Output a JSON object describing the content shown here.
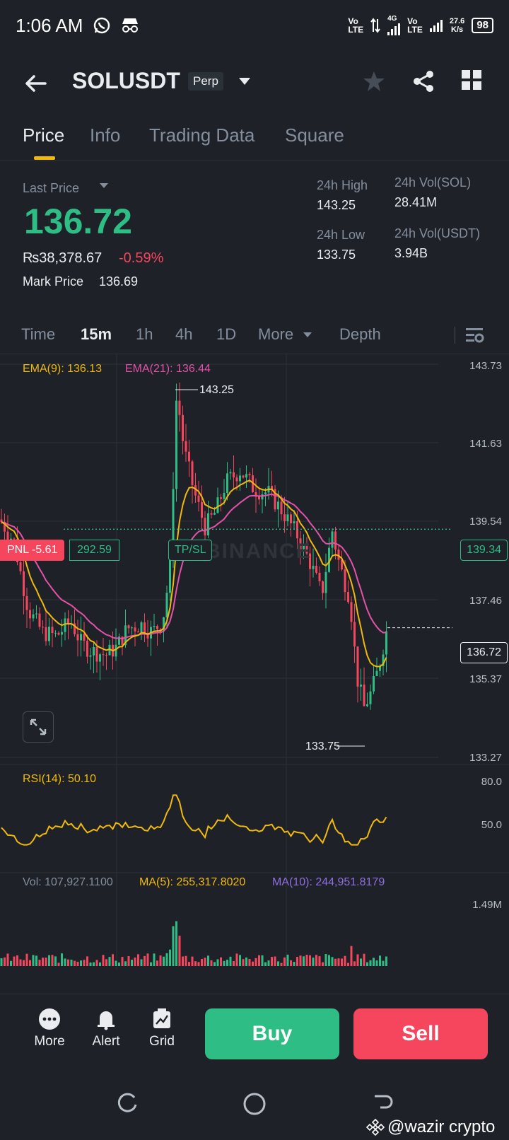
{
  "status_bar": {
    "time": "1:06 AM",
    "net1_top": "Vo",
    "net1_bottom": "LTE",
    "net_4g": "4G",
    "net2_top": "Vo",
    "net2_bottom": "LTE",
    "speed_top": "27.6",
    "speed_bottom": "K/s",
    "battery": "98"
  },
  "header": {
    "symbol": "SOLUSDT",
    "badge": "Perp"
  },
  "tabs": [
    "Price",
    "Info",
    "Trading Data",
    "Square"
  ],
  "price_panel": {
    "last_price_label": "Last Price",
    "last_price": "136.72",
    "fiat_price": "₨38,378.67",
    "change_pct": "-0.59%",
    "mark_label": "Mark Price",
    "mark_value": "136.69",
    "high_label": "24h High",
    "high_value": "143.25",
    "low_label": "24h Low",
    "low_value": "133.75",
    "vol_sol_label": "24h Vol(SOL)",
    "vol_sol_value": "28.41M",
    "vol_usdt_label": "24h Vol(USDT)",
    "vol_usdt_value": "3.94B"
  },
  "intervals": {
    "time": "Time",
    "m15": "15m",
    "h1": "1h",
    "h4": "4h",
    "d1": "1D",
    "more": "More",
    "depth": "Depth"
  },
  "chart": {
    "ema9_label": "EMA(9): 136.13",
    "ema21_label": "EMA(21): 136.44",
    "price_axis": [
      "143.73",
      "141.63",
      "139.54",
      "137.46",
      "135.37",
      "133.27"
    ],
    "high_marker": "143.25",
    "low_marker": "133.75",
    "pnl_label": "PNL -5.61",
    "position_qty": "292.59",
    "tpsl_label": "TP/SL",
    "entry_price": "139.34",
    "current_price": "136.72",
    "watermark": "BINANCE",
    "rsi_label": "RSI(14): 50.10",
    "rsi_axis": [
      "80.0",
      "50.0"
    ],
    "vol_label": "Vol: 107,927.1100",
    "ma5_label": "MA(5): 255,317.8020",
    "ma10_label": "MA(10): 244,951.8179",
    "vol_axis": "1.49M",
    "colors": {
      "up": "#2ebd85",
      "down": "#f6465d",
      "ema9": "#f0b90b",
      "ema21": "#e352a8",
      "rsi": "#f0b90b",
      "ma10": "#8f6ee0"
    }
  },
  "chart_data": {
    "type": "candlestick",
    "interval": "15m",
    "price_range": [
      133.27,
      143.73
    ],
    "rsi_range": [
      0,
      100
    ],
    "volume_max": "1.49M",
    "markers": {
      "high": 143.25,
      "low": 133.75,
      "entry": 139.34,
      "last": 136.72
    }
  },
  "bottom_bar": {
    "more": "More",
    "alert": "Alert",
    "grid": "Grid",
    "buy": "Buy",
    "sell": "Sell"
  },
  "credit": "@wazir crypto"
}
